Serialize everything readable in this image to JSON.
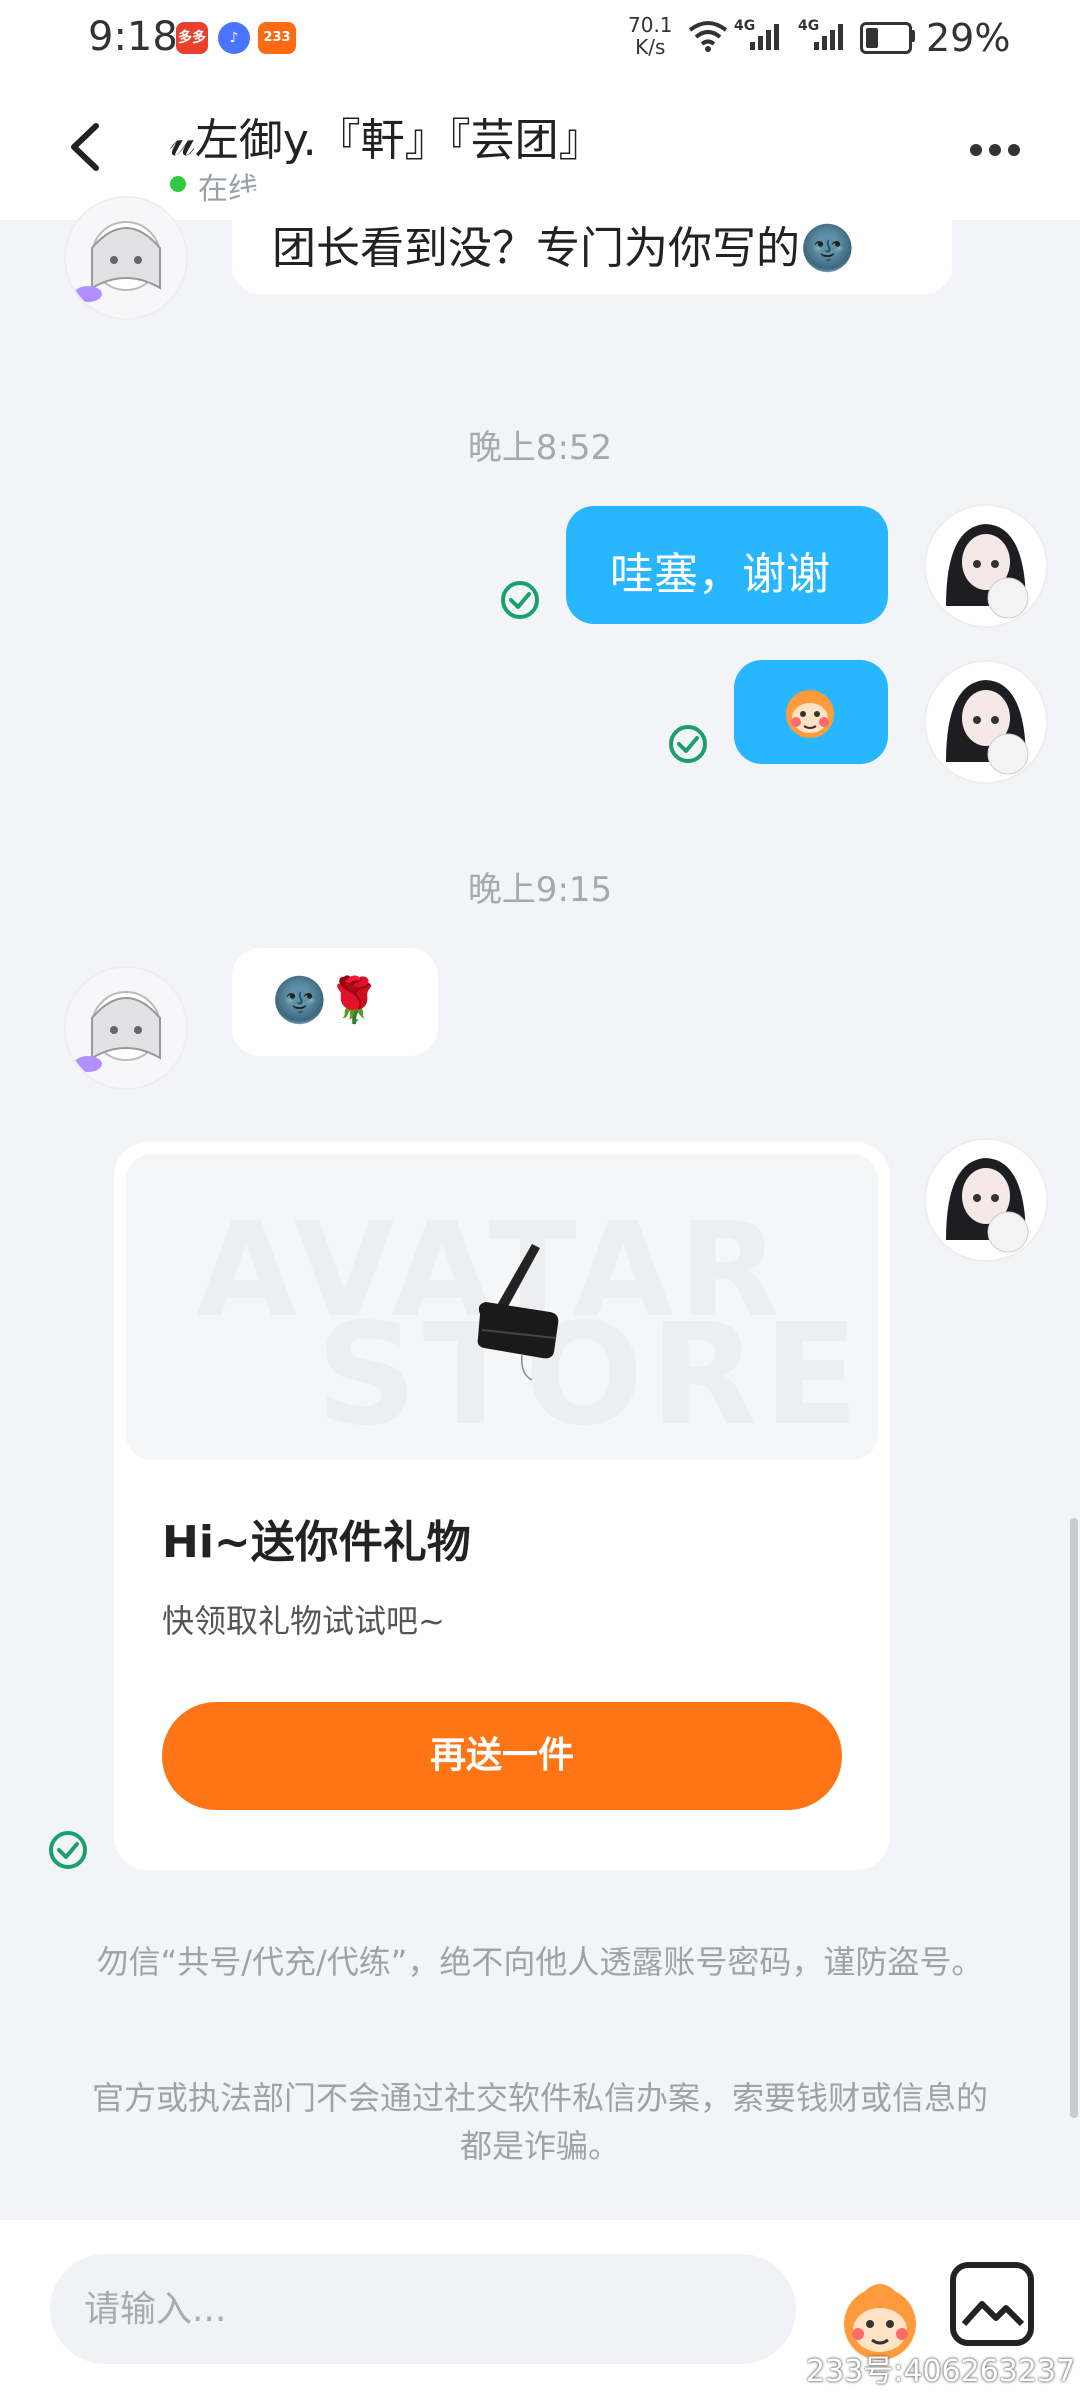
{
  "status_bar": {
    "time": "9:18",
    "app_icons": [
      {
        "name": "shopping-app-icon",
        "text": "多多",
        "color": "#e8402c"
      },
      {
        "name": "music-app-icon",
        "text": "♪",
        "color": "#4a73ff"
      },
      {
        "name": "233-app-icon",
        "text": "233",
        "color": "#ff6a13"
      }
    ],
    "net_speed_value": "70.1",
    "net_speed_unit": "K/s",
    "signal_label_1": "4G",
    "signal_label_2": "4G",
    "battery_level": 0.29,
    "battery_percent": "29%"
  },
  "header": {
    "title": "𝓊左御y.『軒』『芸团』",
    "status": "在线"
  },
  "messages": [
    {
      "type": "in",
      "text": "团长看到没？专门为你写的🌚"
    },
    {
      "type": "time",
      "text": "晚上8:52"
    },
    {
      "type": "out",
      "text": "哇塞，谢谢"
    },
    {
      "type": "out",
      "text": "🐵"
    },
    {
      "type": "time",
      "text": "晚上9:15"
    },
    {
      "type": "in",
      "text": "🌚🌹"
    }
  ],
  "gift_card": {
    "watermark_line1": "AVATAR",
    "watermark_line2": "STORE",
    "title": "Hi~送你件礼物",
    "subtitle": "快领取礼物试试吧~",
    "button_label": "再送一件"
  },
  "notices": [
    "勿信“共号/代充/代练”，绝不向他人透露账号密码，谨防盗号。",
    "官方或执法部门不会通过社交软件私信办案，索要钱财或信息的都是诈骗。"
  ],
  "input": {
    "placeholder": "请输入..."
  },
  "watermark_id": "233号:406263237",
  "colors": {
    "accent_blue": "#28b6ff",
    "gift_button": "#ff7515",
    "online": "#2ecc40",
    "check": "#1aa06d"
  }
}
